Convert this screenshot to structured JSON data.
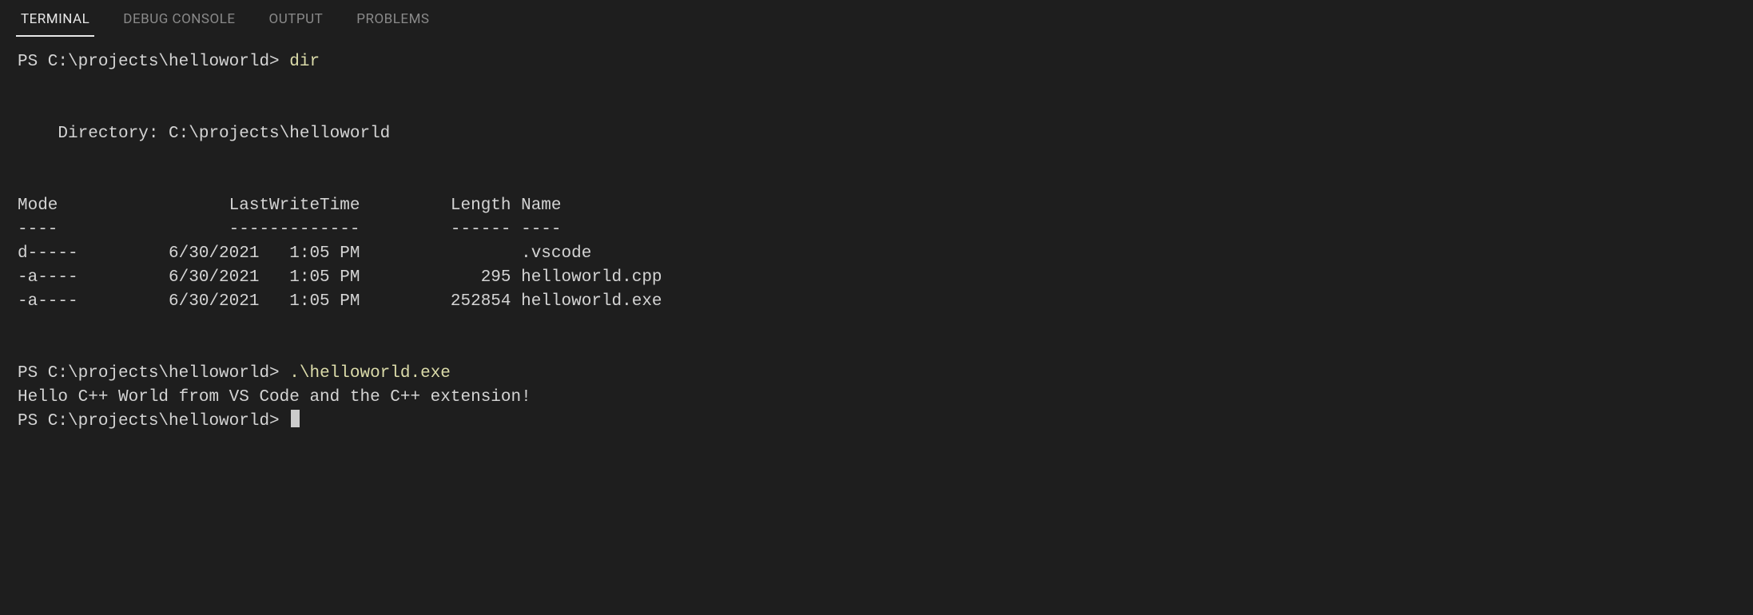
{
  "tabs": {
    "terminal": "TERMINAL",
    "debug_console": "DEBUG CONSOLE",
    "output": "OUTPUT",
    "problems": "PROBLEMS"
  },
  "session": {
    "prompt1": "PS C:\\projects\\helloworld> ",
    "cmd1": "dir",
    "blank1": "",
    "blank2": "",
    "dir_header": "    Directory: C:\\projects\\helloworld",
    "blank3": "",
    "blank4": "",
    "col_header": "Mode                 LastWriteTime         Length Name",
    "col_rule": "----                 -------------         ------ ----",
    "row0": "d-----         6/30/2021   1:05 PM                .vscode",
    "row1": "-a----         6/30/2021   1:05 PM            295 helloworld.cpp",
    "row2": "-a----         6/30/2021   1:05 PM         252854 helloworld.exe",
    "blank5": "",
    "blank6": "",
    "prompt2": "PS C:\\projects\\helloworld> ",
    "cmd2": ".\\helloworld.exe",
    "output1": "Hello C++ World from VS Code and the C++ extension!",
    "prompt3": "PS C:\\projects\\helloworld> "
  }
}
